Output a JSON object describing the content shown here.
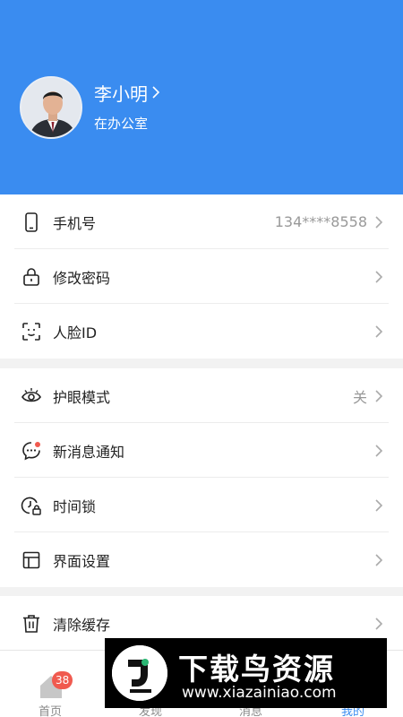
{
  "profile": {
    "name": "李小明",
    "status": "在办公室"
  },
  "section1": {
    "items": [
      {
        "label": "手机号",
        "value": "134****8558",
        "icon": "phone-icon"
      },
      {
        "label": "修改密码",
        "value": "",
        "icon": "lock-icon"
      },
      {
        "label": "人脸ID",
        "value": "",
        "icon": "face-id-icon"
      }
    ]
  },
  "section2": {
    "items": [
      {
        "label": "护眼模式",
        "value": "关",
        "icon": "eye-icon"
      },
      {
        "label": "新消息通知",
        "value": "",
        "icon": "chat-notification-icon"
      },
      {
        "label": "时间锁",
        "value": "",
        "icon": "time-lock-icon"
      },
      {
        "label": "界面设置",
        "value": "",
        "icon": "layout-icon"
      }
    ]
  },
  "section3": {
    "items": [
      {
        "label": "清除缓存",
        "value": "",
        "icon": "trash-icon"
      }
    ]
  },
  "tabbar": {
    "tabs": [
      {
        "label": "首页",
        "badge": "38",
        "icon": "home-icon"
      },
      {
        "label": "发现",
        "icon": "discover-icon"
      },
      {
        "label": "消息",
        "icon": "message-icon"
      },
      {
        "label": "我的",
        "icon": "profile-icon"
      }
    ],
    "active_color": "#3a8cf0"
  },
  "watermark": {
    "title": "下载鸟资源",
    "url": "www.xiazainiao.com"
  },
  "colors": {
    "header": "#3a8cf0",
    "badge": "#f05a4f"
  }
}
